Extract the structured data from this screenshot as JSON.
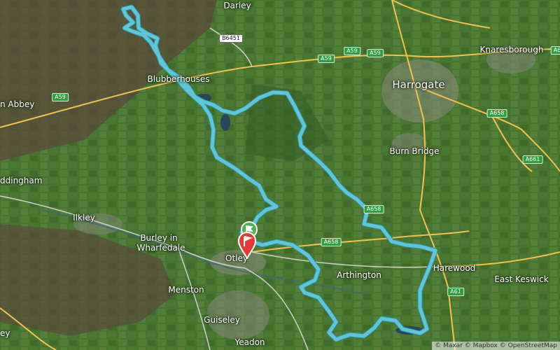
{
  "places": [
    {
      "id": "darley",
      "text": "Darley",
      "kind": "town"
    },
    {
      "id": "knaresborough",
      "text": "Knaresborough",
      "kind": "town"
    },
    {
      "id": "harrogate",
      "text": "Harrogate",
      "kind": "city"
    },
    {
      "id": "blubberhouses",
      "text": "Blubberhouses",
      "kind": "town"
    },
    {
      "id": "abbey",
      "text": "n Abbey",
      "kind": "town"
    },
    {
      "id": "burnbridge",
      "text": "Burn Bridge",
      "kind": "town"
    },
    {
      "id": "addingham",
      "text": "ddingham",
      "kind": "town"
    },
    {
      "id": "ilkley",
      "text": "Ilkley",
      "kind": "town"
    },
    {
      "id": "burley1",
      "text": "Burley in",
      "kind": "town"
    },
    {
      "id": "burley2",
      "text": "Wharfedale",
      "kind": "town"
    },
    {
      "id": "otley",
      "text": "Otley",
      "kind": "town"
    },
    {
      "id": "arthington",
      "text": "Arthington",
      "kind": "town"
    },
    {
      "id": "harewood",
      "text": "Harewood",
      "kind": "town"
    },
    {
      "id": "eastkeswick",
      "text": "East Keswick",
      "kind": "town"
    },
    {
      "id": "menston",
      "text": "Menston",
      "kind": "town"
    },
    {
      "id": "guiseley",
      "text": "Guiseley",
      "kind": "town"
    },
    {
      "id": "yeadon",
      "text": "Yeadon",
      "kind": "town"
    },
    {
      "id": "ey",
      "text": "ey",
      "kind": "town"
    }
  ],
  "road_shields": [
    {
      "id": "b6451",
      "text": "B6451",
      "style": "white"
    },
    {
      "id": "a59a",
      "text": "A59",
      "style": "green"
    },
    {
      "id": "a59b",
      "text": "A59",
      "style": "green"
    },
    {
      "id": "a59c",
      "text": "A59",
      "style": "green"
    },
    {
      "id": "a59w",
      "text": "A59",
      "style": "green"
    },
    {
      "id": "a658a",
      "text": "A658",
      "style": "green"
    },
    {
      "id": "a658b",
      "text": "A658",
      "style": "green"
    },
    {
      "id": "a658c",
      "text": "A658",
      "style": "green"
    },
    {
      "id": "a661",
      "text": "A661",
      "style": "green"
    },
    {
      "id": "a61",
      "text": "A61",
      "style": "green"
    },
    {
      "id": "a6e",
      "text": "A6",
      "style": "green"
    }
  ],
  "attribution": "© Maxar © Mapbox © OpenStreetMap",
  "colors": {
    "route": "#5ec6d6",
    "route_edge": "#2f8fa0",
    "start": "#4caf50",
    "finish": "#e53935",
    "roads": "#f2c14e"
  }
}
